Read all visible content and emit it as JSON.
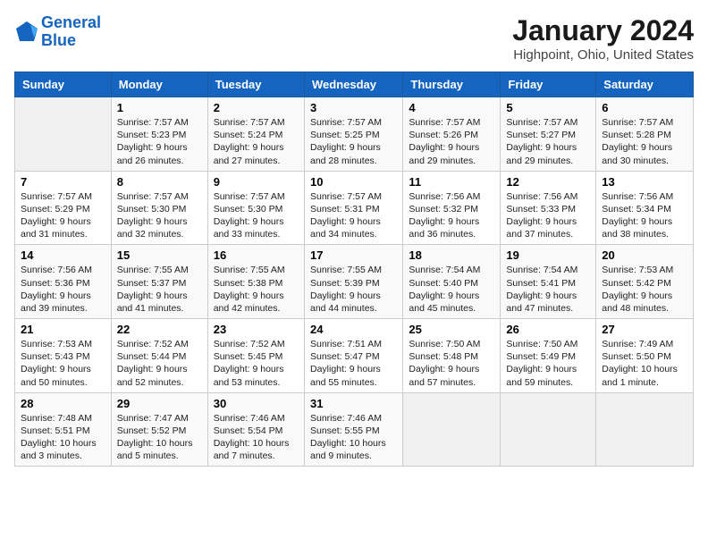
{
  "header": {
    "logo_line1": "General",
    "logo_line2": "Blue",
    "month": "January 2024",
    "location": "Highpoint, Ohio, United States"
  },
  "days_of_week": [
    "Sunday",
    "Monday",
    "Tuesday",
    "Wednesday",
    "Thursday",
    "Friday",
    "Saturday"
  ],
  "weeks": [
    [
      {
        "day": "",
        "sunrise": "",
        "sunset": "",
        "daylight": ""
      },
      {
        "day": "1",
        "sunrise": "Sunrise: 7:57 AM",
        "sunset": "Sunset: 5:23 PM",
        "daylight": "Daylight: 9 hours and 26 minutes."
      },
      {
        "day": "2",
        "sunrise": "Sunrise: 7:57 AM",
        "sunset": "Sunset: 5:24 PM",
        "daylight": "Daylight: 9 hours and 27 minutes."
      },
      {
        "day": "3",
        "sunrise": "Sunrise: 7:57 AM",
        "sunset": "Sunset: 5:25 PM",
        "daylight": "Daylight: 9 hours and 28 minutes."
      },
      {
        "day": "4",
        "sunrise": "Sunrise: 7:57 AM",
        "sunset": "Sunset: 5:26 PM",
        "daylight": "Daylight: 9 hours and 29 minutes."
      },
      {
        "day": "5",
        "sunrise": "Sunrise: 7:57 AM",
        "sunset": "Sunset: 5:27 PM",
        "daylight": "Daylight: 9 hours and 29 minutes."
      },
      {
        "day": "6",
        "sunrise": "Sunrise: 7:57 AM",
        "sunset": "Sunset: 5:28 PM",
        "daylight": "Daylight: 9 hours and 30 minutes."
      }
    ],
    [
      {
        "day": "7",
        "sunrise": "Sunrise: 7:57 AM",
        "sunset": "Sunset: 5:29 PM",
        "daylight": "Daylight: 9 hours and 31 minutes."
      },
      {
        "day": "8",
        "sunrise": "Sunrise: 7:57 AM",
        "sunset": "Sunset: 5:30 PM",
        "daylight": "Daylight: 9 hours and 32 minutes."
      },
      {
        "day": "9",
        "sunrise": "Sunrise: 7:57 AM",
        "sunset": "Sunset: 5:30 PM",
        "daylight": "Daylight: 9 hours and 33 minutes."
      },
      {
        "day": "10",
        "sunrise": "Sunrise: 7:57 AM",
        "sunset": "Sunset: 5:31 PM",
        "daylight": "Daylight: 9 hours and 34 minutes."
      },
      {
        "day": "11",
        "sunrise": "Sunrise: 7:56 AM",
        "sunset": "Sunset: 5:32 PM",
        "daylight": "Daylight: 9 hours and 36 minutes."
      },
      {
        "day": "12",
        "sunrise": "Sunrise: 7:56 AM",
        "sunset": "Sunset: 5:33 PM",
        "daylight": "Daylight: 9 hours and 37 minutes."
      },
      {
        "day": "13",
        "sunrise": "Sunrise: 7:56 AM",
        "sunset": "Sunset: 5:34 PM",
        "daylight": "Daylight: 9 hours and 38 minutes."
      }
    ],
    [
      {
        "day": "14",
        "sunrise": "Sunrise: 7:56 AM",
        "sunset": "Sunset: 5:36 PM",
        "daylight": "Daylight: 9 hours and 39 minutes."
      },
      {
        "day": "15",
        "sunrise": "Sunrise: 7:55 AM",
        "sunset": "Sunset: 5:37 PM",
        "daylight": "Daylight: 9 hours and 41 minutes."
      },
      {
        "day": "16",
        "sunrise": "Sunrise: 7:55 AM",
        "sunset": "Sunset: 5:38 PM",
        "daylight": "Daylight: 9 hours and 42 minutes."
      },
      {
        "day": "17",
        "sunrise": "Sunrise: 7:55 AM",
        "sunset": "Sunset: 5:39 PM",
        "daylight": "Daylight: 9 hours and 44 minutes."
      },
      {
        "day": "18",
        "sunrise": "Sunrise: 7:54 AM",
        "sunset": "Sunset: 5:40 PM",
        "daylight": "Daylight: 9 hours and 45 minutes."
      },
      {
        "day": "19",
        "sunrise": "Sunrise: 7:54 AM",
        "sunset": "Sunset: 5:41 PM",
        "daylight": "Daylight: 9 hours and 47 minutes."
      },
      {
        "day": "20",
        "sunrise": "Sunrise: 7:53 AM",
        "sunset": "Sunset: 5:42 PM",
        "daylight": "Daylight: 9 hours and 48 minutes."
      }
    ],
    [
      {
        "day": "21",
        "sunrise": "Sunrise: 7:53 AM",
        "sunset": "Sunset: 5:43 PM",
        "daylight": "Daylight: 9 hours and 50 minutes."
      },
      {
        "day": "22",
        "sunrise": "Sunrise: 7:52 AM",
        "sunset": "Sunset: 5:44 PM",
        "daylight": "Daylight: 9 hours and 52 minutes."
      },
      {
        "day": "23",
        "sunrise": "Sunrise: 7:52 AM",
        "sunset": "Sunset: 5:45 PM",
        "daylight": "Daylight: 9 hours and 53 minutes."
      },
      {
        "day": "24",
        "sunrise": "Sunrise: 7:51 AM",
        "sunset": "Sunset: 5:47 PM",
        "daylight": "Daylight: 9 hours and 55 minutes."
      },
      {
        "day": "25",
        "sunrise": "Sunrise: 7:50 AM",
        "sunset": "Sunset: 5:48 PM",
        "daylight": "Daylight: 9 hours and 57 minutes."
      },
      {
        "day": "26",
        "sunrise": "Sunrise: 7:50 AM",
        "sunset": "Sunset: 5:49 PM",
        "daylight": "Daylight: 9 hours and 59 minutes."
      },
      {
        "day": "27",
        "sunrise": "Sunrise: 7:49 AM",
        "sunset": "Sunset: 5:50 PM",
        "daylight": "Daylight: 10 hours and 1 minute."
      }
    ],
    [
      {
        "day": "28",
        "sunrise": "Sunrise: 7:48 AM",
        "sunset": "Sunset: 5:51 PM",
        "daylight": "Daylight: 10 hours and 3 minutes."
      },
      {
        "day": "29",
        "sunrise": "Sunrise: 7:47 AM",
        "sunset": "Sunset: 5:52 PM",
        "daylight": "Daylight: 10 hours and 5 minutes."
      },
      {
        "day": "30",
        "sunrise": "Sunrise: 7:46 AM",
        "sunset": "Sunset: 5:54 PM",
        "daylight": "Daylight: 10 hours and 7 minutes."
      },
      {
        "day": "31",
        "sunrise": "Sunrise: 7:46 AM",
        "sunset": "Sunset: 5:55 PM",
        "daylight": "Daylight: 10 hours and 9 minutes."
      },
      {
        "day": "",
        "sunrise": "",
        "sunset": "",
        "daylight": ""
      },
      {
        "day": "",
        "sunrise": "",
        "sunset": "",
        "daylight": ""
      },
      {
        "day": "",
        "sunrise": "",
        "sunset": "",
        "daylight": ""
      }
    ]
  ]
}
